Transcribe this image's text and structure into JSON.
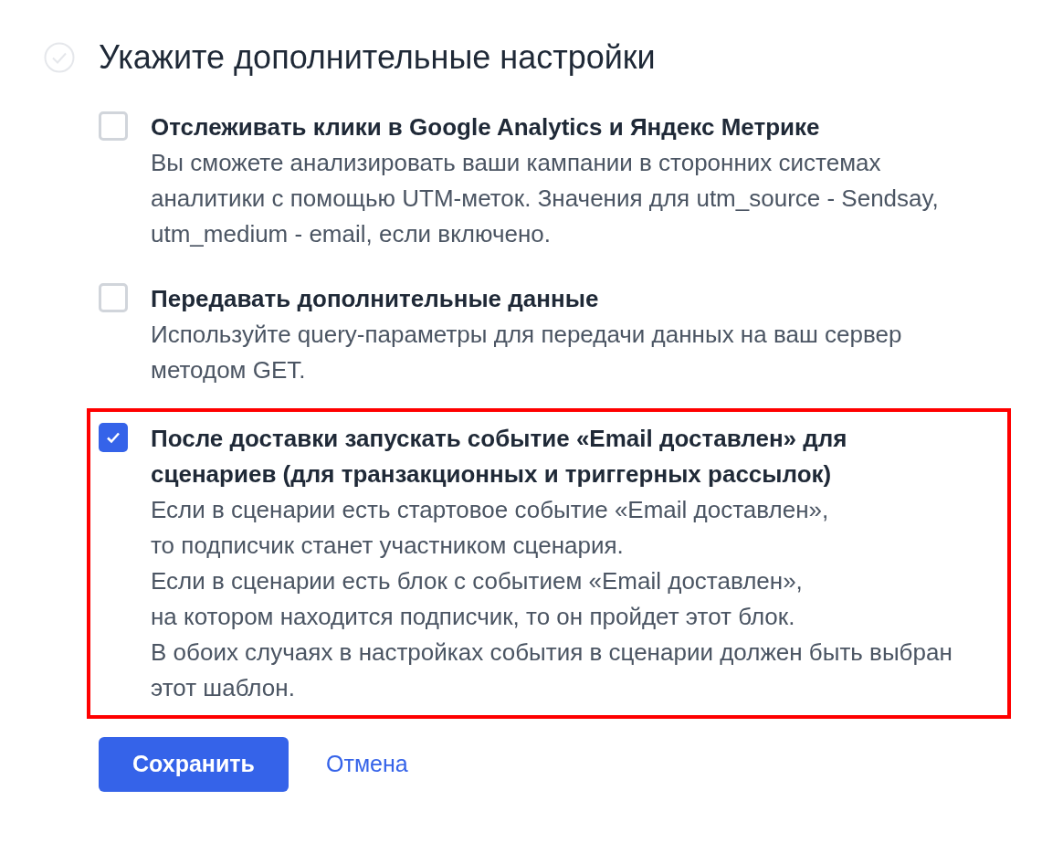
{
  "heading": {
    "title": "Укажите дополнительные настройки",
    "done": false
  },
  "options": [
    {
      "label": "Отслеживать клики в Google Analytics и Яндекс Метрике",
      "checked": false,
      "highlighted": false,
      "paragraphs": [
        "Вы сможете анализировать ваши кампании в сторонних системах аналитики с помощью UTM-меток. Значения для utm_source - Sendsay, utm_medium - email, если включено."
      ]
    },
    {
      "label": "Передавать дополнительные данные",
      "checked": false,
      "highlighted": false,
      "paragraphs": [
        "Используйте query-параметры для передачи данных на ваш сервер методом GET."
      ]
    },
    {
      "label": "После доставки запускать событие «Email доставлен» для сценариев (для транзакционных и триггерных рассылок)",
      "checked": true,
      "highlighted": true,
      "paragraphs": [
        "Если в сценарии есть стартовое событие «Email доставлен»,\nто подписчик станет участником сценария.",
        "Если в сценарии есть блок с событием «Email доставлен»,\nна котором находится подписчик, то он пройдет этот блок.",
        "В обоих случаях в настройках события в сценарии должен быть выбран этот шаблон."
      ]
    }
  ],
  "buttons": {
    "save": "Сохранить",
    "cancel": "Отмена"
  }
}
